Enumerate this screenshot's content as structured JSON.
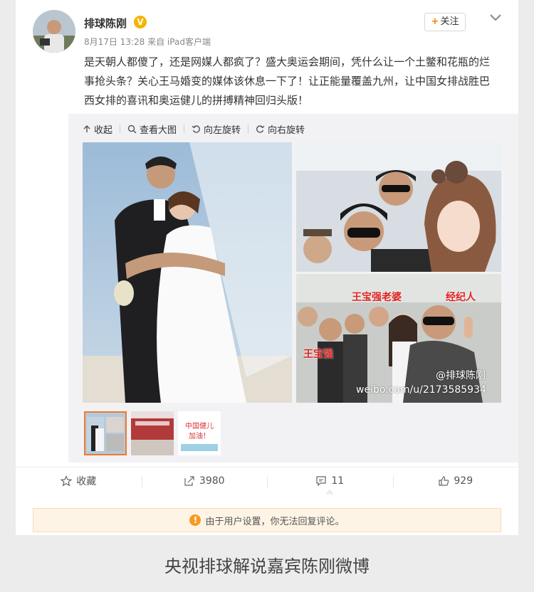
{
  "post": {
    "username": "排球陈刚",
    "verified_badge": "V",
    "date": "8月17日 13:28",
    "source": "来自 iPad客户端",
    "follow_label": "关注",
    "follow_plus": "+",
    "text": "是天朝人都傻了，还是网媒人都疯了？盛大奥运会期间，凭什么让一个土鳖和花瓶的烂事抢头条？关心王马婚变的媒体该休息一下了！让正能量覆盖九州，让中国女排战胜巴西女排的喜讯和奥运健儿的拼搏精神回归头版！"
  },
  "toolbar": {
    "collapse": "收起",
    "view_large": "查看大图",
    "rotate_left": "向左旋转",
    "rotate_right": "向右旋转"
  },
  "photo": {
    "tag_wife": "王宝强老婆",
    "tag_agent": "经纪人",
    "tag_wang": "王宝强",
    "watermark_user": "@排球陈刚",
    "watermark_url": "weibo.com/u/2173585934"
  },
  "thumbnails": {
    "third_text": "中国健儿\n加油！"
  },
  "actions": {
    "favorite": "收藏",
    "repost_count": "3980",
    "comment_count": "11",
    "like_count": "929"
  },
  "notice": {
    "icon": "!",
    "text": "由于用户设置，你无法回复评论。"
  },
  "caption": "央视排球解说嘉宾陈刚微博",
  "colors": {
    "accent_orange": "#ff8200",
    "verified_gold": "#f5b400",
    "notice_bg": "#fef4e6",
    "tag_red": "#e02020"
  }
}
